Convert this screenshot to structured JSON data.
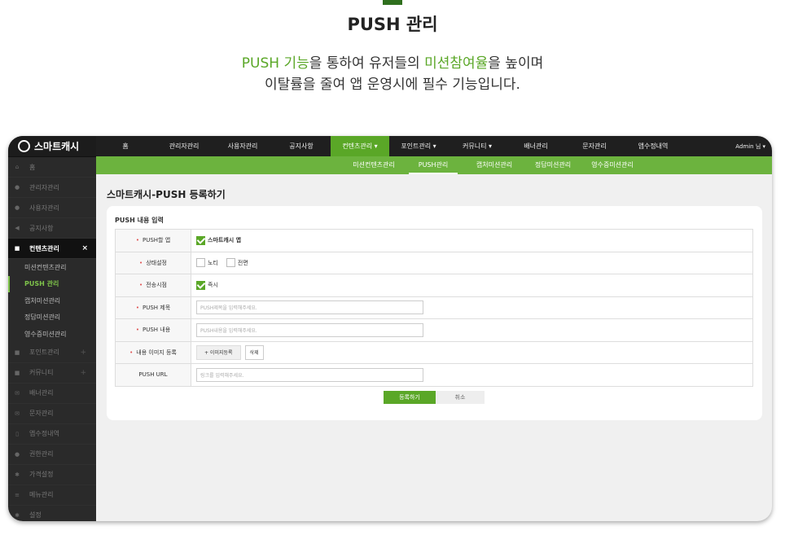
{
  "hero": {
    "title": "PUSH 관리",
    "line1_a": "PUSH 기능",
    "line1_b": "을 통하여 유저들의 ",
    "line1_c": "미션참여율",
    "line1_d": "을 높이며",
    "line2": "이탈률을 줄여 앱 운영시에 필수 기능입니다."
  },
  "colors": {
    "accent": "#5aa727",
    "subnav": "#6cb33e",
    "sidebar": "#2a2a2a",
    "topnav": "#1f1f1f"
  },
  "sidebar": {
    "logo": "스마트캐시",
    "items_top": [
      {
        "label": "홈",
        "icon": "home-icon"
      },
      {
        "label": "관리자관리",
        "icon": "user-icon"
      },
      {
        "label": "사용자관리",
        "icon": "user-icon"
      },
      {
        "label": "공지사항",
        "icon": "speaker-icon"
      }
    ],
    "active": {
      "label": "컨텐츠관리",
      "icon": "bag-icon",
      "close": "×"
    },
    "sub_items": [
      "미션컨텐츠관리",
      "PUSH 관리",
      "캡처미션관리",
      "정답미션관리",
      "영수증미션관리"
    ],
    "items_bottom": [
      {
        "label": "포인트관리",
        "plus": "+"
      },
      {
        "label": "커뮤니티",
        "plus": "+"
      },
      {
        "label": "배너관리",
        "plus": ""
      },
      {
        "label": "문자관리",
        "plus": ""
      },
      {
        "label": "앱수정내역",
        "plus": ""
      },
      {
        "label": "권한관리",
        "plus": ""
      },
      {
        "label": "가격설정",
        "plus": ""
      },
      {
        "label": "메뉴관리",
        "plus": ""
      },
      {
        "label": "설정",
        "plus": ""
      }
    ]
  },
  "topnav": {
    "items": [
      "홈",
      "관리자관리",
      "사용자관리",
      "공지사항",
      "컨텐츠관리 ▾",
      "포인트관리 ▾",
      "커뮤니티 ▾",
      "배너관리",
      "문자관리",
      "앱수정내역"
    ],
    "admin": "Admin 님 ▾"
  },
  "subnav": {
    "items": [
      "미션컨텐츠관리",
      "PUSH관리",
      "캡처미션관리",
      "정답미션관리",
      "영수증미션관리"
    ]
  },
  "page": {
    "title": "스마트캐시-PUSH 등록하기"
  },
  "form": {
    "section_title": "PUSH 내용 입력",
    "app_label": "PUSH할 앱",
    "app_value": "스마트캐시 앱",
    "status_label": "상태설정",
    "status_opt1": "노티",
    "status_opt2": "전면",
    "send_label": "전송시점",
    "send_value": "즉시",
    "subject_label": "PUSH 제목",
    "subject_placeholder": "PUSH제목을 입력해주세요.",
    "content_label": "PUSH 내용",
    "content_placeholder": "PUSH내용을 입력해주세요.",
    "image_label": "내용 이미지 등록",
    "image_button": "+ 이미지등록",
    "delete_button": "삭제",
    "url_label": "PUSH URL",
    "url_placeholder": "링크를 입력해주세요.",
    "required_mark": "•",
    "submit": "등록하기",
    "cancel": "취소"
  }
}
